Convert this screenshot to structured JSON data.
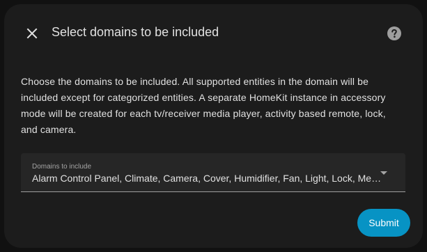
{
  "dialog": {
    "title": "Select domains to be included",
    "close_icon": "close-icon",
    "help_icon": "help-circle-icon",
    "description": "Choose the domains to be included. All supported entities in the domain will be included except for categorized entities. A separate HomeKit instance in accessory mode will be created for each tv/receiver media player, activity based remote, lock, and camera.",
    "domains_field": {
      "label": "Domains to include",
      "value": "Alarm Control Panel, Climate, Camera, Cover, Humidifier, Fan, Light, Lock, Media Player, Remote, Switch, Vacuum, Water Heater"
    },
    "submit_label": "Submit"
  },
  "colors": {
    "accent": "#0793c4",
    "surface": "#1c1c1c",
    "background": "#111111",
    "text": "#e1e1e1"
  }
}
